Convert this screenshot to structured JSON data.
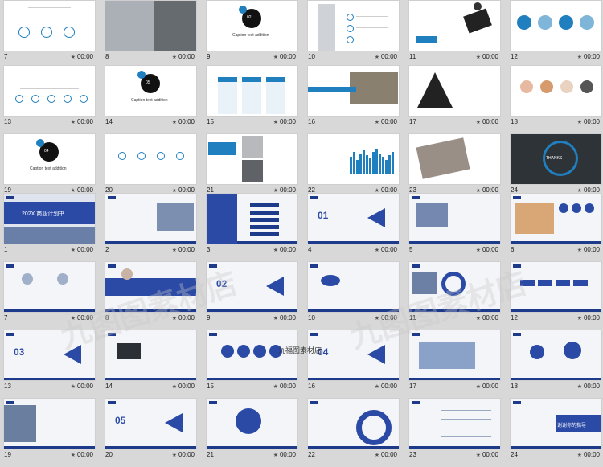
{
  "rows": [
    [
      {
        "num": "7",
        "time": "00:00",
        "kind": "circles-white",
        "caption": ""
      },
      {
        "num": "8",
        "time": "00:00",
        "kind": "photo-office",
        "caption": ""
      },
      {
        "num": "9",
        "time": "00:00",
        "kind": "splash",
        "caption": "Caption text addition",
        "badge": "02"
      },
      {
        "num": "10",
        "time": "00:00",
        "kind": "woman-list",
        "caption": ""
      },
      {
        "num": "11",
        "time": "00:00",
        "kind": "laptop-desk",
        "caption": ""
      },
      {
        "num": "12",
        "time": "00:00",
        "kind": "stat-circles",
        "caption": ""
      }
    ],
    [
      {
        "num": "13",
        "time": "00:00",
        "kind": "org-tree",
        "caption": ""
      },
      {
        "num": "14",
        "time": "00:00",
        "kind": "splash",
        "caption": "Caption text addition",
        "badge": "05"
      },
      {
        "num": "15",
        "time": "00:00",
        "kind": "price-table",
        "caption": ""
      },
      {
        "num": "16",
        "time": "00:00",
        "kind": "office-photo",
        "caption": ""
      },
      {
        "num": "17",
        "time": "00:00",
        "kind": "triangle",
        "caption": ""
      },
      {
        "num": "18",
        "time": "00:00",
        "kind": "food-circles",
        "caption": ""
      }
    ],
    [
      {
        "num": "19",
        "time": "00:00",
        "kind": "splash",
        "caption": "Caption text addition",
        "badge": "04"
      },
      {
        "num": "20",
        "time": "00:00",
        "kind": "icon-rows",
        "caption": ""
      },
      {
        "num": "21",
        "time": "00:00",
        "kind": "photo-collage",
        "caption": ""
      },
      {
        "num": "22",
        "time": "00:00",
        "kind": "bar-chart",
        "caption": ""
      },
      {
        "num": "23",
        "time": "00:00",
        "kind": "cards",
        "caption": ""
      },
      {
        "num": "24",
        "time": "00:00",
        "kind": "thanks",
        "caption": "THANKS"
      }
    ],
    [
      {
        "num": "1",
        "time": "00:00",
        "kind": "blue-cover",
        "caption": "202X 商业计划书"
      },
      {
        "num": "2",
        "time": "00:00",
        "kind": "blue-building",
        "caption": ""
      },
      {
        "num": "3",
        "time": "00:00",
        "kind": "blue-agenda",
        "caption": ""
      },
      {
        "num": "4",
        "time": "00:00",
        "kind": "section",
        "caption": "01"
      },
      {
        "num": "5",
        "time": "00:00",
        "kind": "blue-city",
        "caption": ""
      },
      {
        "num": "6",
        "time": "00:00",
        "kind": "blue-people",
        "caption": ""
      }
    ],
    [
      {
        "num": "7",
        "time": "00:00",
        "kind": "blue-avatars",
        "caption": ""
      },
      {
        "num": "8",
        "time": "00:00",
        "kind": "blue-person-band",
        "caption": ""
      },
      {
        "num": "9",
        "time": "00:00",
        "kind": "section",
        "caption": "02"
      },
      {
        "num": "10",
        "time": "00:00",
        "kind": "blue-cloud",
        "caption": ""
      },
      {
        "num": "11",
        "time": "00:00",
        "kind": "blue-donut",
        "caption": ""
      },
      {
        "num": "12",
        "time": "00:00",
        "kind": "blue-arrows",
        "caption": ""
      }
    ],
    [
      {
        "num": "13",
        "time": "00:00",
        "kind": "section",
        "caption": "03"
      },
      {
        "num": "14",
        "time": "00:00",
        "kind": "blue-device",
        "caption": ""
      },
      {
        "num": "15",
        "time": "00:00",
        "kind": "blue-4circles",
        "caption": ""
      },
      {
        "num": "16",
        "time": "00:00",
        "kind": "section",
        "caption": "04"
      },
      {
        "num": "17",
        "time": "00:00",
        "kind": "blue-map",
        "caption": ""
      },
      {
        "num": "18",
        "time": "00:00",
        "kind": "blue-bubbles",
        "caption": ""
      }
    ],
    [
      {
        "num": "19",
        "time": "00:00",
        "kind": "blue-handshake",
        "caption": ""
      },
      {
        "num": "20",
        "time": "00:00",
        "kind": "section",
        "caption": "05"
      },
      {
        "num": "21",
        "time": "00:00",
        "kind": "blue-clover",
        "caption": ""
      },
      {
        "num": "22",
        "time": "00:00",
        "kind": "blue-pie",
        "caption": ""
      },
      {
        "num": "23",
        "time": "00:00",
        "kind": "blue-lines",
        "caption": ""
      },
      {
        "num": "24",
        "time": "00:00",
        "kind": "blue-thanks",
        "caption": "谢谢你的指导"
      }
    ]
  ],
  "watermark_center": "九福图素材店",
  "watermark_big": "九图图素材店",
  "colors": {
    "accent": "#1f7fbf",
    "navy": "#1e3a8a",
    "blue": "#2b4aa6",
    "bg": "#d8d8d8"
  }
}
